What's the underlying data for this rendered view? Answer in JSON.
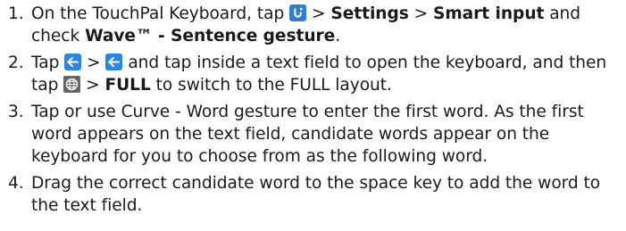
{
  "steps": [
    {
      "num": "1.",
      "t1": "On the TouchPal Keyboard, tap ",
      "t2": " > ",
      "b1": "Settings",
      "t3": " > ",
      "b2": "Smart input",
      "t4": " and check ",
      "b3": "Wave™ - Sentence gesture",
      "t5": "."
    },
    {
      "num": "2.",
      "t1": "Tap ",
      "t2": " > ",
      "t3": " and tap inside a text field to open the keyboard, and then tap ",
      "t4": " > ",
      "b1": "FULL",
      "t5": " to switch to the FULL layout."
    },
    {
      "num": "3.",
      "text": "Tap or use Curve - Word gesture to enter the first word. As the first word appears on the text field, candidate words appear on the keyboard for you to choose from as the following word."
    },
    {
      "num": "4.",
      "text": "Drag the correct candidate word to the space key to add the word to the text field."
    }
  ],
  "icons": {
    "touchpal_logo": "touchpal-logo-icon",
    "back_arrow": "back-arrow-icon",
    "globe": "globe-icon"
  },
  "colors": {
    "text": "#1a1a1a",
    "touchpal_blue": "#2f7fd0",
    "back_blue": "#2a86de",
    "globe_gray": "#666666"
  }
}
